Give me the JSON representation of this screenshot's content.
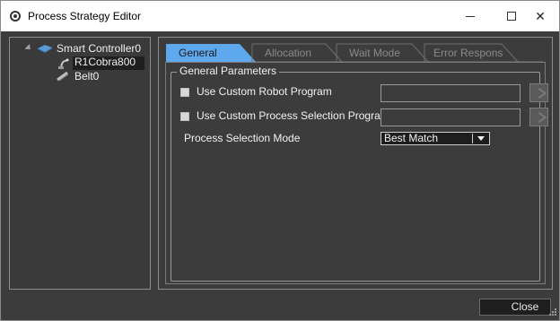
{
  "window": {
    "title": "Process Strategy Editor",
    "minimize_icon": "minimize-icon",
    "maximize_icon": "maximize-icon",
    "close_glyph": "✕"
  },
  "tree": {
    "nodes": [
      {
        "label": "Smart Controller0",
        "icon": "controller-icon",
        "expanded": true
      },
      {
        "label": "R1Cobra800",
        "icon": "robot-icon",
        "selected": true
      },
      {
        "label": "Belt0",
        "icon": "belt-icon"
      }
    ]
  },
  "tabs": [
    {
      "label": "General",
      "active": true
    },
    {
      "label": "Allocation",
      "active": false
    },
    {
      "label": "Wait Mode",
      "active": false
    },
    {
      "label": "Error Respons",
      "active": false
    }
  ],
  "general": {
    "group_title": "General Parameters",
    "use_custom_robot_program": {
      "label": "Use Custom Robot Program",
      "checked": false,
      "value": ""
    },
    "use_custom_process_selection": {
      "label": "Use Custom Process Selection Program",
      "checked": false,
      "value": ""
    },
    "process_selection_mode": {
      "label": "Process Selection Mode",
      "selected": "Best Match"
    }
  },
  "footer": {
    "close_label": "Close"
  },
  "colors": {
    "active_tab": "#5ea8ee",
    "panel_bg": "#3c3c3c",
    "text": "#f2f2f2"
  }
}
